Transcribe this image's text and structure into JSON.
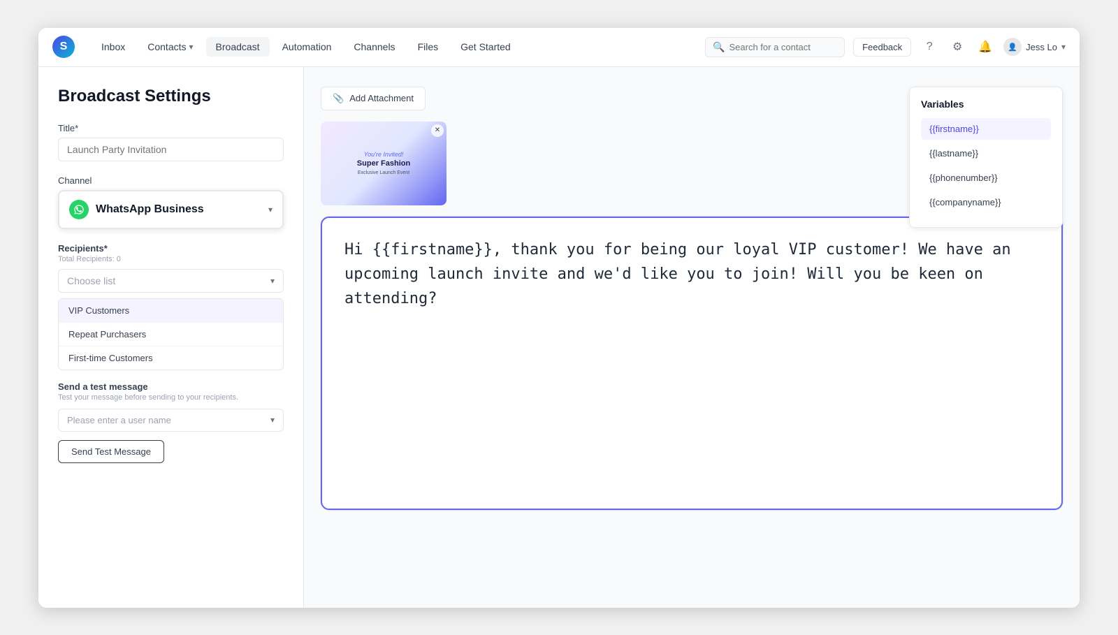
{
  "app": {
    "logo_text": "S"
  },
  "nav": {
    "items": [
      {
        "id": "inbox",
        "label": "Inbox",
        "active": false
      },
      {
        "id": "contacts",
        "label": "Contacts",
        "active": false,
        "has_dropdown": true
      },
      {
        "id": "broadcast",
        "label": "Broadcast",
        "active": true
      },
      {
        "id": "automation",
        "label": "Automation",
        "active": false
      },
      {
        "id": "channels",
        "label": "Channels",
        "active": false
      },
      {
        "id": "files",
        "label": "Files",
        "active": false
      },
      {
        "id": "get-started",
        "label": "Get Started",
        "active": false
      }
    ],
    "search_placeholder": "Search for a contact",
    "feedback_label": "Feedback",
    "user_name": "Jess Lo"
  },
  "page": {
    "title": "Broadcast Settings"
  },
  "form": {
    "title_label": "Title*",
    "title_placeholder": "Launch Party Invitation",
    "channel_label": "Channel",
    "channel_value": "WhatsApp Business",
    "recipients_label": "Recipients*",
    "recipients_sub": "Total Recipients: 0",
    "choose_list_placeholder": "Choose list",
    "list_options": [
      {
        "id": "vip",
        "label": "VIP Customers",
        "selected": true
      },
      {
        "id": "repeat",
        "label": "Repeat Purchasers",
        "selected": false
      },
      {
        "id": "firsttime",
        "label": "First-time Customers",
        "selected": false
      }
    ],
    "send_test_title": "Send a test message",
    "send_test_sub": "Test your message before sending to your recipients.",
    "user_name_placeholder": "Please enter a user name",
    "send_test_btn": "Send Test Message"
  },
  "attachment": {
    "add_btn_label": "Add Attachment",
    "preview_invited": "You're Invited!",
    "preview_title": "Super Fashion",
    "preview_sub": "Exclusive Launch Event"
  },
  "message": {
    "content": "Hi {{firstname}}, thank you for being our loyal VIP customer! We have an upcoming launch invite and we'd like you to join! Will you be keen on attending?"
  },
  "variables": {
    "title": "Variables",
    "items": [
      {
        "id": "firstname",
        "label": "{{firstname}}",
        "highlighted": true
      },
      {
        "id": "lastname",
        "label": "{{lastname}}",
        "highlighted": false
      },
      {
        "id": "phonenumber",
        "label": "{{phonenumber}}",
        "highlighted": false
      },
      {
        "id": "companyname",
        "label": "{{companyname}}",
        "highlighted": false
      }
    ]
  }
}
